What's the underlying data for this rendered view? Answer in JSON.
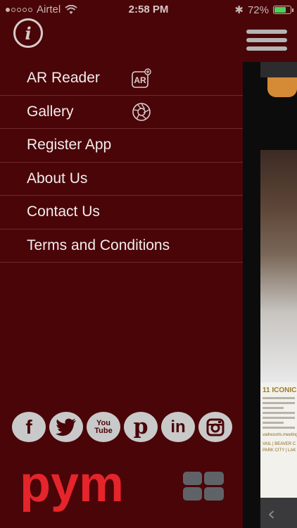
{
  "status_bar": {
    "carrier": "Airtel",
    "time": "2:58 PM",
    "battery_percent": "72%",
    "battery_level": 0.72,
    "battery_color": "#49d35c"
  },
  "header": {
    "info_icon": "info-icon",
    "menu_icon": "hamburger-menu-icon"
  },
  "menu": {
    "items": [
      {
        "label": "AR Reader",
        "icon": "ar-reader-icon"
      },
      {
        "label": "Gallery",
        "icon": "gallery-aperture-icon"
      },
      {
        "label": "Register App"
      },
      {
        "label": "About Us"
      },
      {
        "label": "Contact Us"
      },
      {
        "label": "Terms and Conditions"
      }
    ]
  },
  "preview": {
    "headline": "11 ICONIC",
    "link_text": "vailresorts.meetings",
    "footer_line1": "VAIL | BEAVER C",
    "footer_line2": "PARK CITY | LAK"
  },
  "social": {
    "icons": [
      "facebook-icon",
      "twitter-icon",
      "youtube-icon",
      "pinterest-icon",
      "linkedin-icon",
      "instagram-icon"
    ],
    "youtube_label": "You Tube",
    "linkedin_label": "in",
    "facebook_label": "f",
    "pinterest_label": "p"
  },
  "logo": {
    "text": "pym",
    "text_color": "#e5252b",
    "mark_color": "#5f6368"
  }
}
